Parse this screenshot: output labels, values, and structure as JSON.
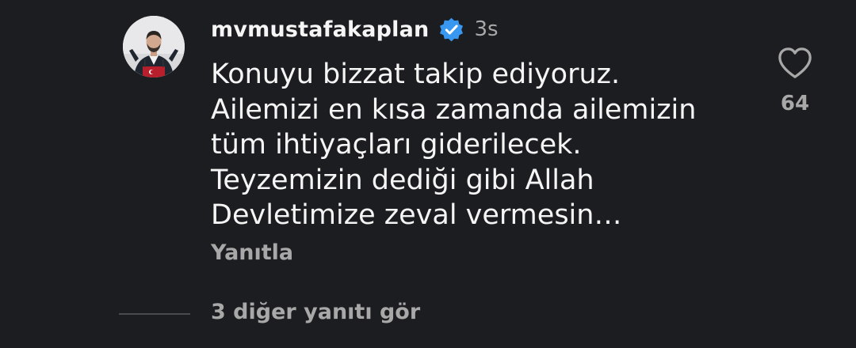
{
  "comment": {
    "avatar_icon": "profile-photo",
    "username": "mvmustafakaplan",
    "verified_icon": "verified-badge-icon",
    "verified_color": "#3897f0",
    "time": "3s",
    "lines": [
      "Konuyu bizzat takip ediyoruz.",
      "Ailemizi en kısa zamanda ailemizin",
      "tüm ihtiyaçları giderilecek.",
      "Teyzemizin dediği gibi Allah",
      "Devletimize zeval vermesin…"
    ],
    "reply_label": "Yanıtla",
    "like_icon": "heart-outline-icon",
    "like_count": "64",
    "view_replies_label": "3 diğer yanıtı gör"
  },
  "colors": {
    "background": "#1c1d20",
    "primary_text": "#f5f5f5",
    "secondary_text": "#a8a8a8"
  }
}
